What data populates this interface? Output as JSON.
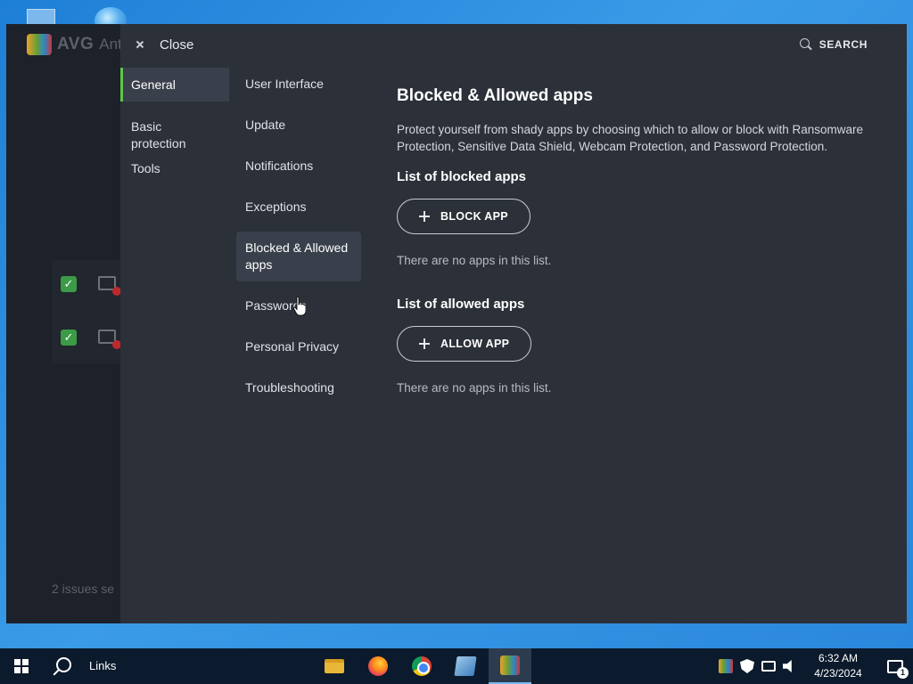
{
  "background_app": {
    "logo_text": "AVG",
    "logo_sub": "Ant",
    "issues_text": "2 issues se"
  },
  "settings": {
    "close_label": "Close",
    "search_label": "SEARCH",
    "categories": [
      {
        "label": "General",
        "active": true
      },
      {
        "label": "Basic protection",
        "active": false
      },
      {
        "label": "Tools",
        "active": false
      }
    ],
    "subcategories": [
      {
        "label": "User Interface"
      },
      {
        "label": "Update"
      },
      {
        "label": "Notifications"
      },
      {
        "label": "Exceptions"
      },
      {
        "label": "Blocked & Allowed apps",
        "active": true
      },
      {
        "label": "Passwords"
      },
      {
        "label": "Personal Privacy"
      },
      {
        "label": "Troubleshooting"
      }
    ],
    "content": {
      "title": "Blocked & Allowed apps",
      "description": "Protect yourself from shady apps by choosing which to allow or block with Ransomware Protection, Sensitive Data Shield, Webcam Protection, and Password Protection.",
      "blocked_section_title": "List of blocked apps",
      "block_button": "BLOCK APP",
      "blocked_empty": "There are no apps in this list.",
      "allowed_section_title": "List of allowed apps",
      "allow_button": "ALLOW APP",
      "allowed_empty": "There are no apps in this list."
    },
    "accent_color": "#5ec54b"
  },
  "taskbar": {
    "links_label": "Links",
    "apps": [
      {
        "icon": "file-explorer-icon"
      },
      {
        "icon": "firefox-icon"
      },
      {
        "icon": "chrome-icon"
      },
      {
        "icon": "tool-app-icon"
      },
      {
        "icon": "avg-icon",
        "active": true
      }
    ],
    "clock_time": "6:32 AM",
    "clock_date": "4/23/2024",
    "notification_count": "1"
  }
}
